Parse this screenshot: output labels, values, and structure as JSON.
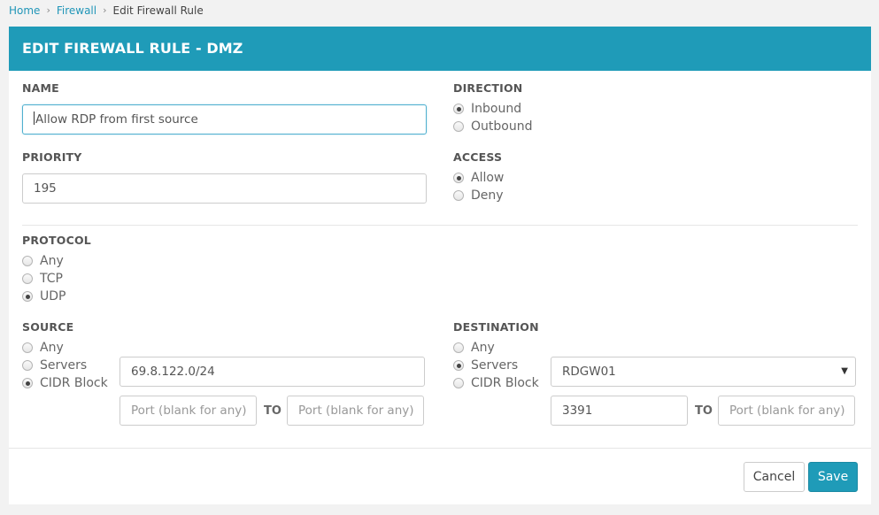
{
  "breadcrumb": {
    "home": "Home",
    "firewall": "Firewall",
    "current": "Edit Firewall Rule",
    "separator": "›"
  },
  "header": {
    "title": "EDIT FIREWALL RULE - DMZ"
  },
  "name": {
    "label": "NAME",
    "value": "Allow RDP from first source"
  },
  "priority": {
    "label": "PRIORITY",
    "value": "195"
  },
  "direction": {
    "label": "DIRECTION",
    "options": [
      "Inbound",
      "Outbound"
    ],
    "selected": "Inbound"
  },
  "access": {
    "label": "ACCESS",
    "options": [
      "Allow",
      "Deny"
    ],
    "selected": "Allow"
  },
  "protocol": {
    "label": "PROTOCOL",
    "options": [
      "Any",
      "TCP",
      "UDP"
    ],
    "selected": "UDP"
  },
  "source": {
    "label": "SOURCE",
    "options": [
      "Any",
      "Servers",
      "CIDR Block"
    ],
    "selected": "CIDR Block",
    "cidr_value": "69.8.122.0/24",
    "port_from_placeholder": "Port (blank for any)",
    "port_to_placeholder": "Port (blank for any)",
    "to_label": "TO"
  },
  "destination": {
    "label": "DESTINATION",
    "options": [
      "Any",
      "Servers",
      "CIDR Block"
    ],
    "selected": "Servers",
    "server_value": "RDGW01",
    "port_from_value": "3391",
    "port_to_placeholder": "Port (blank for any)",
    "to_label": "TO"
  },
  "buttons": {
    "cancel": "Cancel",
    "save": "Save"
  },
  "colors": {
    "accent": "#1f9bb8",
    "link": "#2196b8"
  },
  "icons": {
    "select": "chevron-down-icon"
  }
}
